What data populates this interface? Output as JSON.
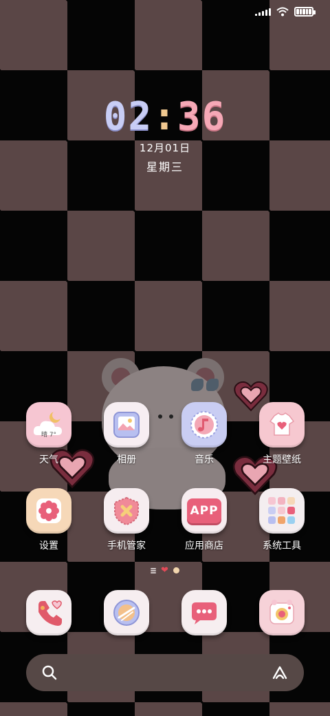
{
  "status_bar": {
    "icons": [
      "signal-icon",
      "wifi-icon",
      "battery-icon"
    ]
  },
  "clock": {
    "hours": "02",
    "separator": ":",
    "minutes": "36",
    "date": "12月01日",
    "weekday": "星期三"
  },
  "apps": [
    {
      "label": "天气",
      "icon": "weather-icon",
      "tile_color": "#f6c6d2",
      "weather_text": "晴 7°"
    },
    {
      "label": "相册",
      "icon": "gallery-icon",
      "tile_color": "#f7eef2"
    },
    {
      "label": "音乐",
      "icon": "music-icon",
      "tile_color": "#c9cdf3"
    },
    {
      "label": "主题壁纸",
      "icon": "theme-icon",
      "tile_color": "#f6c8d0"
    },
    {
      "label": "设置",
      "icon": "settings-icon",
      "tile_color": "#f6d8b8"
    },
    {
      "label": "手机管家",
      "icon": "phone-manager-icon",
      "tile_color": "#f6edf0"
    },
    {
      "label": "应用商店",
      "icon": "app-store-icon",
      "tile_color": "#f7edf0",
      "badge_text": "APP"
    },
    {
      "label": "系统工具",
      "icon": "system-tools-icon",
      "tile_color": "#f4eef0"
    }
  ],
  "dock": [
    {
      "icon": "phone-icon",
      "tile_color": "#f6eef0"
    },
    {
      "icon": "browser-icon",
      "tile_color": "#f6eef0"
    },
    {
      "icon": "messages-icon",
      "tile_color": "#f6eef0"
    },
    {
      "icon": "camera-icon",
      "tile_color": "#f6d2d8"
    }
  ],
  "page_indicator": {
    "pages": 3,
    "current": 2
  },
  "search_bar": {
    "left_icon": "search-icon",
    "right_icon": "assistant-icon"
  },
  "colors": {
    "checker_dark": "#050505",
    "checker_light": "#5a4646",
    "clock_hours": "#c8cdf5",
    "clock_minutes": "#f6a8b6",
    "clock_colon": "#f0c890",
    "accent_pink": "#e8607a",
    "search_bar": "#564846"
  }
}
